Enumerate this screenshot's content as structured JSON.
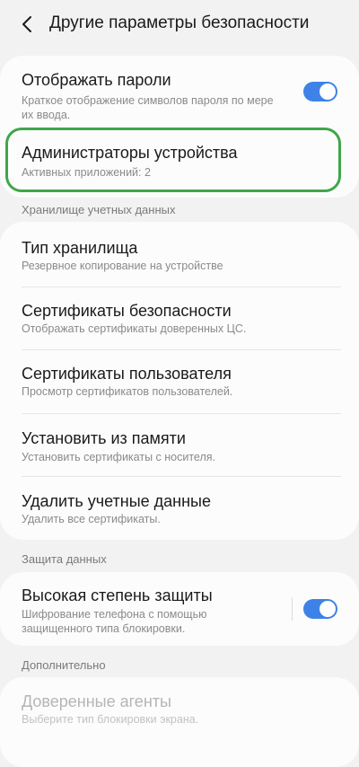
{
  "header": {
    "title": "Другие параметры безопасности"
  },
  "show_passwords": {
    "title": "Отображать пароли",
    "subtitle_line1": "Краткое отображение символов пароля по мере",
    "subtitle_line2": "их ввода.",
    "enabled": true
  },
  "device_admins": {
    "title": "Администраторы устройства",
    "subtitle": "Активных приложений: 2"
  },
  "credential_storage": {
    "section_label": "Хранилище учетных данных",
    "items": [
      {
        "title": "Тип хранилища",
        "subtitle": "Резервное копирование на устройстве"
      },
      {
        "title": "Сертификаты безопасности",
        "subtitle": "Отображать сертификаты доверенных ЦС."
      },
      {
        "title": "Сертификаты пользователя",
        "subtitle": "Просмотр сертификатов пользователей."
      },
      {
        "title": "Установить из памяти",
        "subtitle": "Установить сертификаты с носителя."
      },
      {
        "title": "Удалить учетные данные",
        "subtitle": "Удалить все сертификаты."
      }
    ]
  },
  "data_protection": {
    "section_label": "Защита данных",
    "title": "Высокая степень защиты",
    "subtitle_line1": "Шифрование телефона с помощью",
    "subtitle_line2": "защищенного типа блокировки.",
    "enabled": true
  },
  "advanced": {
    "section_label": "Дополнительно",
    "title": "Доверенные агенты",
    "subtitle": "Выберите тип блокировки экрана."
  },
  "colors": {
    "accent": "#3e82e8",
    "highlight": "#3fa64a"
  }
}
